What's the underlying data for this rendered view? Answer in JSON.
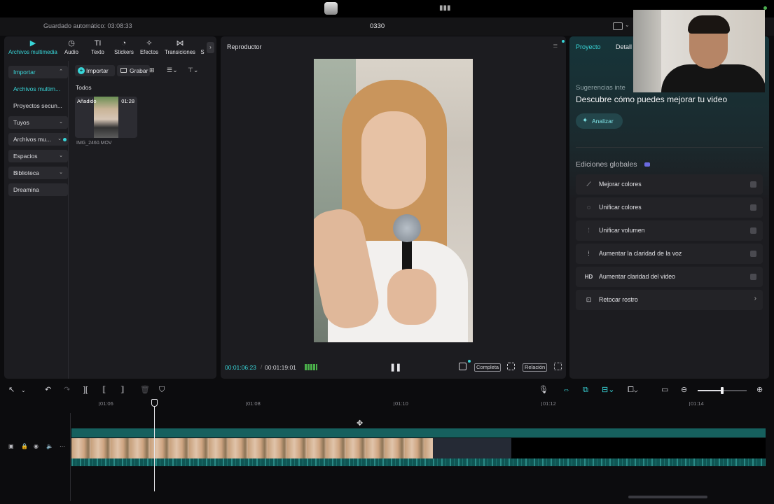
{
  "app": {
    "autosave_label": "Guardado automático: 03:08:33",
    "project_name": "0330"
  },
  "left_panel": {
    "tabs": [
      {
        "label": "Archivos multimedia",
        "icon": "media-icon",
        "active": true
      },
      {
        "label": "Audio",
        "icon": "audio-icon"
      },
      {
        "label": "Texto",
        "icon": "text-icon"
      },
      {
        "label": "Stickers",
        "icon": "sticker-icon"
      },
      {
        "label": "Efectos",
        "icon": "effects-icon"
      },
      {
        "label": "Transiciones",
        "icon": "transitions-icon"
      },
      {
        "label": "S",
        "icon": "more-icon"
      }
    ],
    "nav": [
      {
        "label": "Importar",
        "expanded": true
      },
      {
        "label": "Archivos multim..."
      },
      {
        "label": "Proyectos secun..."
      },
      {
        "label": "Tuyos"
      },
      {
        "label": "Archivos mu..."
      },
      {
        "label": "Espacios"
      },
      {
        "label": "Biblioteca"
      },
      {
        "label": "Dreamina"
      }
    ],
    "import_button": "Importar",
    "record_button": "Grabar",
    "section_title": "Todos",
    "media": {
      "badge": "Añadido",
      "duration": "01:28",
      "filename": "IMG_2460.MOV"
    }
  },
  "player": {
    "title": "Reproductor",
    "current_time": "00:01:06:23",
    "total_time": "00:01:19:01",
    "full_label": "Completa",
    "ratio_label": "Relación"
  },
  "right_panel": {
    "tabs": [
      "Proyecto",
      "Detall"
    ],
    "suggestions_label": "Sugerencias inte",
    "suggestions_title": "Descubre cómo puedes mejorar tu video",
    "analyze_button": "Analizar",
    "global_title": "Ediciones globales",
    "global_items": [
      {
        "label": "Mejorar colores",
        "icon": "magic-wand-icon"
      },
      {
        "label": "Unificar colores",
        "icon": "color-match-icon"
      },
      {
        "label": "Unificar volumen",
        "icon": "sliders-icon"
      },
      {
        "label": "Aumentar la claridad de la voz",
        "icon": "voice-enhance-icon"
      },
      {
        "label": "Aumentar claridad del video",
        "icon": "hd-icon"
      },
      {
        "label": "Retocar rostro",
        "icon": "face-retouch-icon"
      }
    ]
  },
  "timeline": {
    "ruler_labels": [
      "01:06",
      "01:08",
      "01:10",
      "01:12",
      "01:14"
    ]
  },
  "colors": {
    "accent": "#38d5d8",
    "panel": "#1c1c20",
    "background": "#0c0c0e",
    "audio_band": "#16605e"
  }
}
